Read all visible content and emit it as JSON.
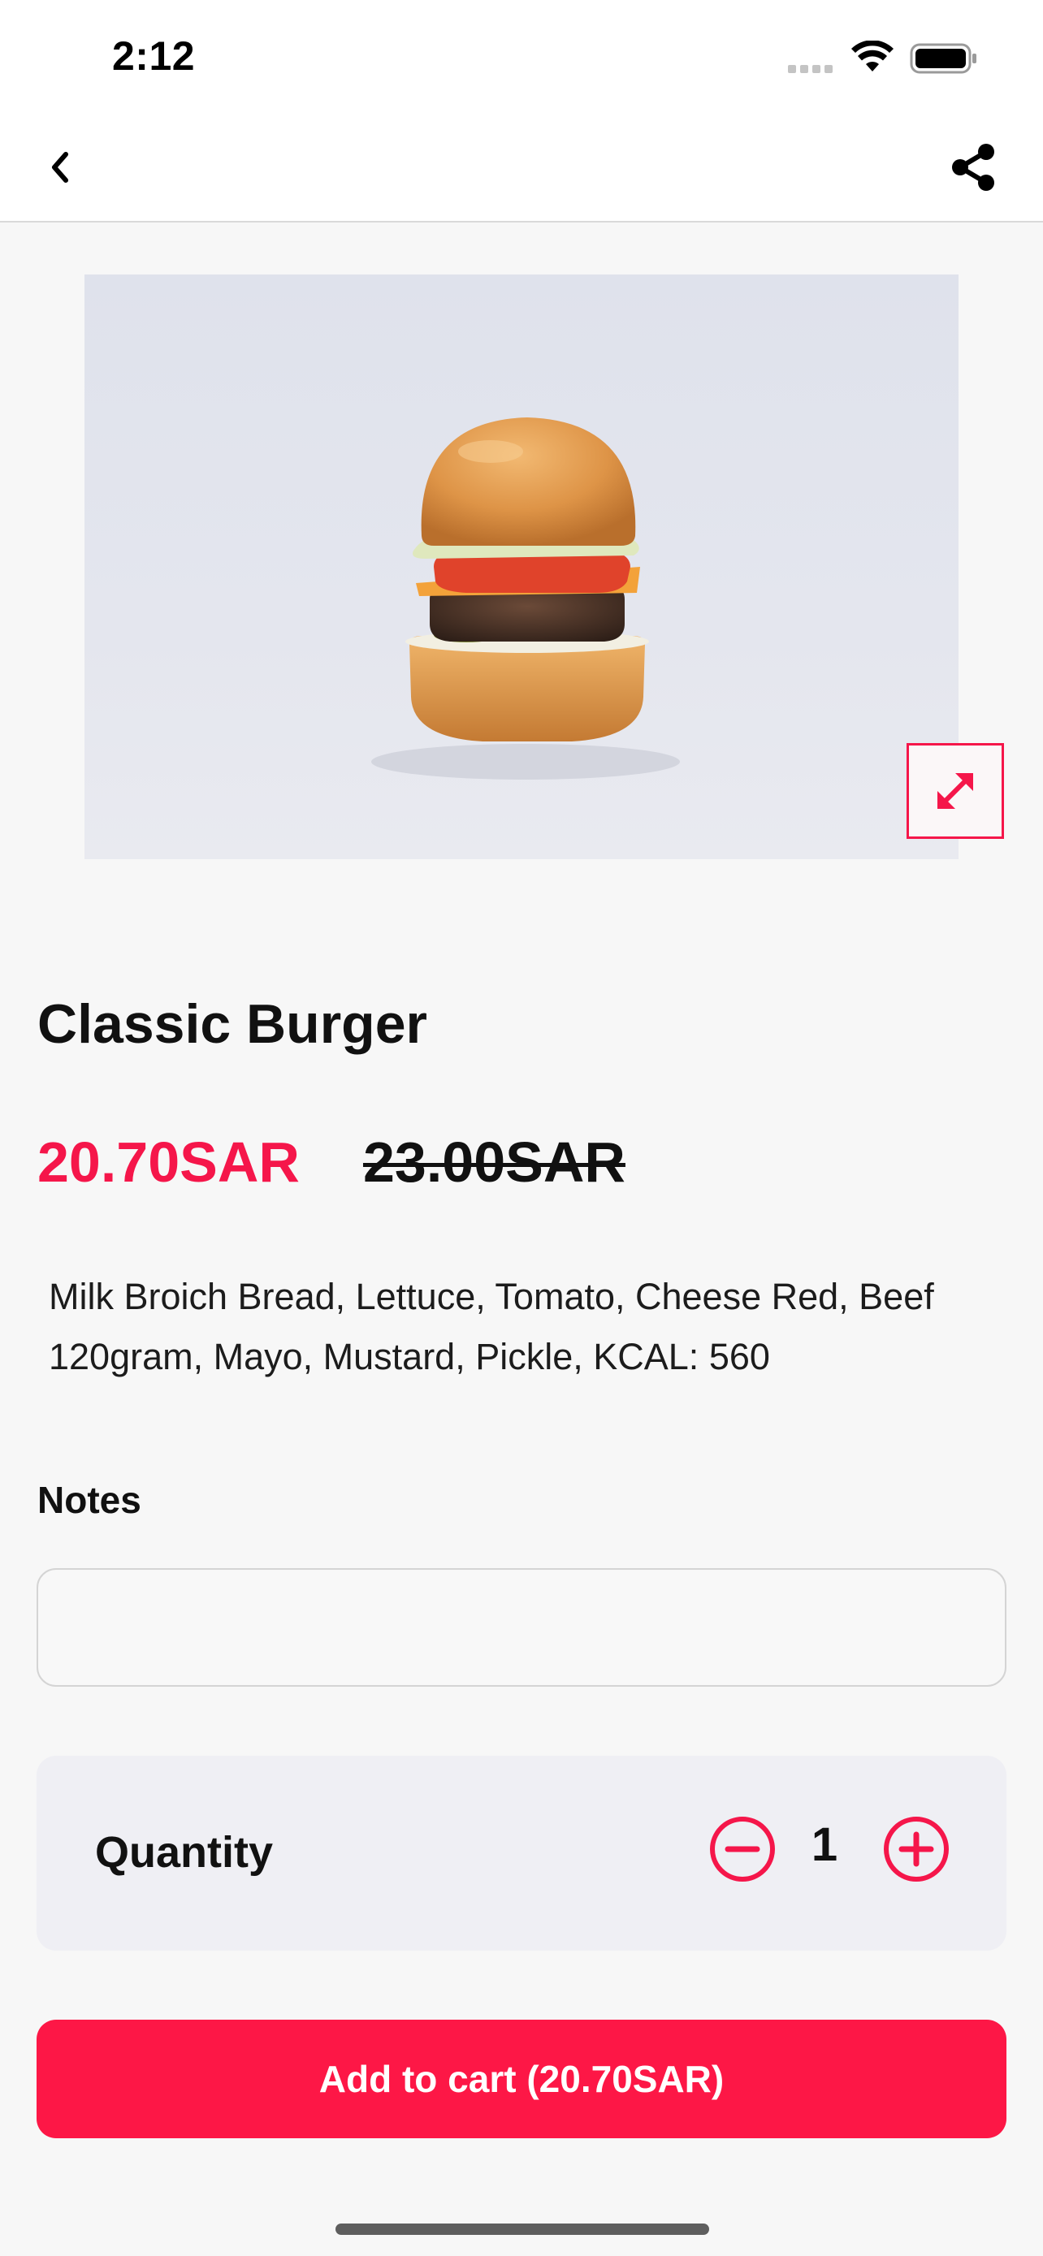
{
  "status_bar": {
    "time": "2:12"
  },
  "nav": {
    "back_icon": "chevron-left-icon",
    "share_icon": "share-icon"
  },
  "product": {
    "image_subject": "burger photo",
    "expand_icon": "expand-arrows-icon",
    "title": "Classic Burger",
    "price_current": "20.70SAR",
    "price_original": "23.00SAR",
    "description": "Milk Broich Bread, Lettuce, Tomato, Cheese Red, Beef 120gram, Mayo, Mustard, Pickle, KCAL: 560"
  },
  "notes": {
    "label": "Notes",
    "value": "",
    "placeholder": ""
  },
  "quantity": {
    "label": "Quantity",
    "value": "1",
    "minus_icon": "minus-circle-icon",
    "plus_icon": "plus-circle-icon"
  },
  "cart_button": {
    "label": "Add to cart (20.70SAR)"
  },
  "colors": {
    "accent": "#f5164a",
    "button": "#fd1746",
    "background": "#f7f7f7",
    "card": "#efeff4"
  }
}
